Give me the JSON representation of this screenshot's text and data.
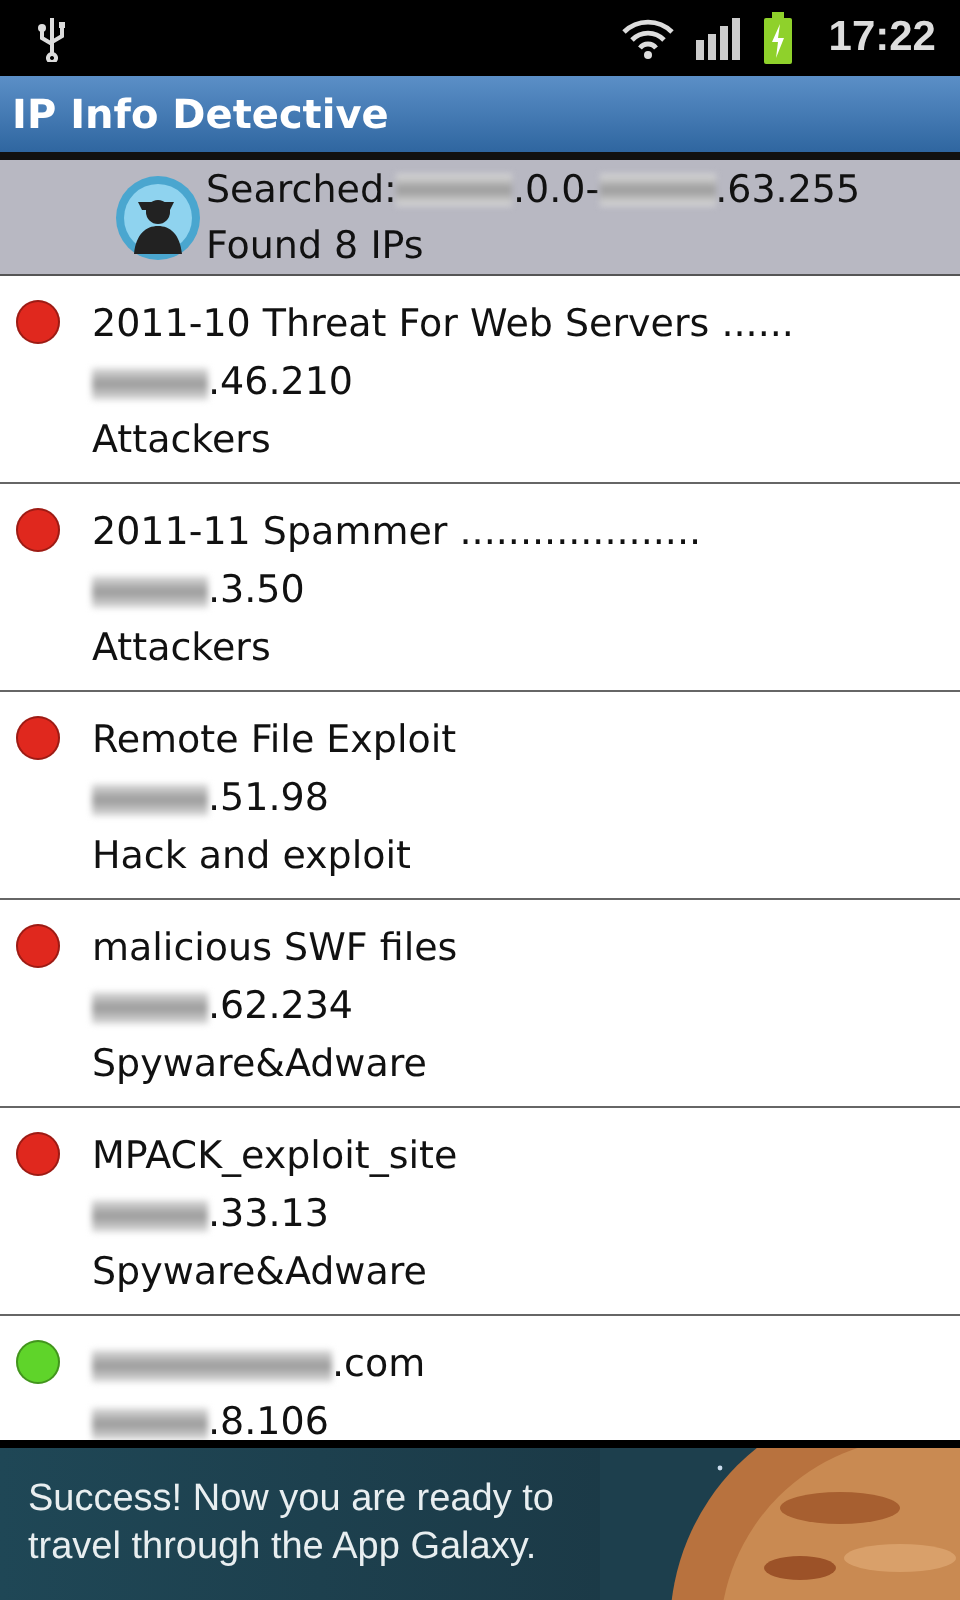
{
  "status_bar": {
    "time": "17:22"
  },
  "app_bar": {
    "title": "IP Info Detective"
  },
  "summary": {
    "label": "Searched:",
    "range_start": ".0.0-",
    "range_end": ".63.255",
    "found": "Found 8 IPs"
  },
  "results": [
    {
      "name": "2011-10 Threat For Web Servers ......",
      "name_redacted": false,
      "ip": ".46.210",
      "category": "Attackers",
      "color": "#e0281e"
    },
    {
      "name": "2011-11 Spammer ....................",
      "name_redacted": false,
      "ip": ".3.50",
      "category": "Attackers",
      "color": "#e0281e"
    },
    {
      "name": "Remote File Exploit",
      "name_redacted": false,
      "ip": ".51.98",
      "category": "Hack and exploit",
      "color": "#e0281e"
    },
    {
      "name": "malicious SWF files",
      "name_redacted": false,
      "ip": ".62.234",
      "category": "Spyware&Adware",
      "color": "#e0281e"
    },
    {
      "name": "MPACK_exploit_site",
      "name_redacted": false,
      "ip": ".33.13",
      "category": "Spyware&Adware",
      "color": "#e0281e"
    },
    {
      "name": ".com",
      "name_redacted": true,
      "ip": ".8.106",
      "color": "#5fd42a"
    }
  ],
  "banner": {
    "text": "Success! Now you are ready to travel through the App Galaxy."
  }
}
